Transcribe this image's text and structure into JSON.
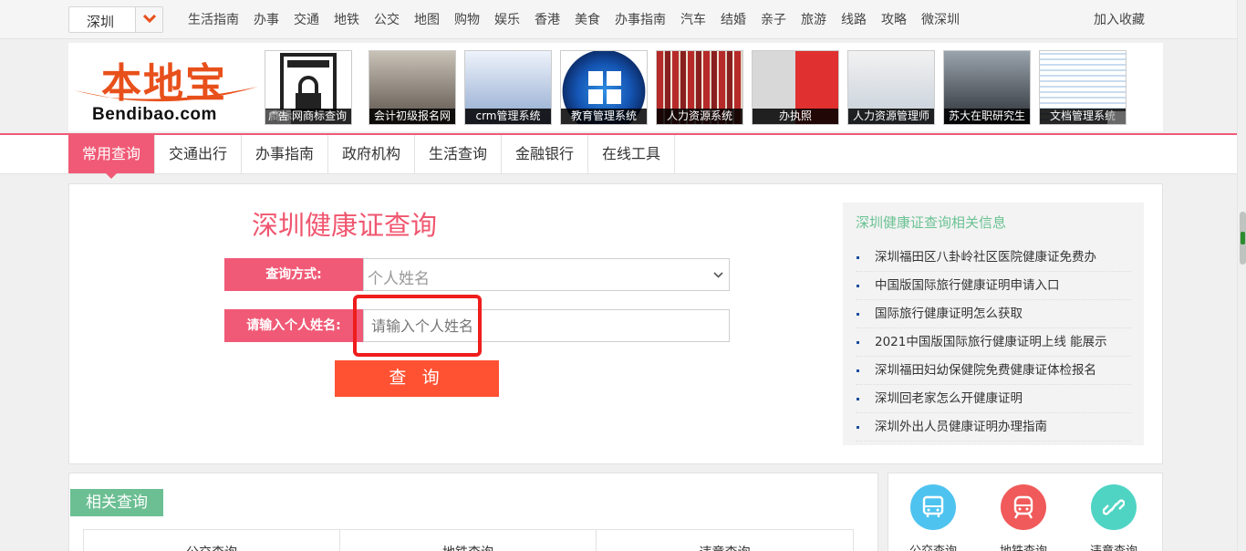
{
  "topbar": {
    "city": "深圳",
    "nav": [
      "生活指南",
      "办事",
      "交通",
      "地铁",
      "公交",
      "地图",
      "购物",
      "娱乐",
      "香港",
      "美食",
      "办事指南",
      "汽车",
      "结婚",
      "亲子",
      "旅游",
      "线路",
      "攻略",
      "微深圳"
    ],
    "favorite": "加入收藏"
  },
  "logo": {
    "cn": "本地宝",
    "en": "Bendibao.com"
  },
  "ads": {
    "tag": "广告",
    "items": [
      "商标网商标查询",
      "会计初级报名网",
      "crm管理系统",
      "教育管理系统",
      "人力资源系统",
      "办执照",
      "人力资源管理师",
      "苏大在职研究生",
      "文档管理系统"
    ]
  },
  "tabs": [
    "常用查询",
    "交通出行",
    "办事指南",
    "政府机构",
    "生活查询",
    "金融银行",
    "在线工具"
  ],
  "query": {
    "title": "深圳健康证查询",
    "method_label": "查询方式:",
    "method_value": "个人姓名",
    "name_label": "请输入个人姓名:",
    "name_placeholder": "请输入个人姓名",
    "submit": "查 询"
  },
  "related_info": {
    "title": "深圳健康证查询相关信息",
    "items": [
      "深圳福田区八卦岭社区医院健康证免费办",
      "中国版国际旅行健康证明申请入口",
      "国际旅行健康证明怎么获取",
      "2021中国版国际旅行健康证明上线 能展示",
      "深圳福田妇幼保健院免费健康证体检报名",
      "深圳回老家怎么开健康证明",
      "深圳外出人员健康证明办理指南"
    ]
  },
  "related_queries": {
    "title": "相关查询",
    "columns": [
      "公交查询",
      "地铁查询",
      "违章查询"
    ]
  },
  "quick_icons": [
    {
      "label": "公交查询",
      "color": "#4fc3ef",
      "icon": "bus-icon"
    },
    {
      "label": "地铁查询",
      "color": "#f05a5a",
      "icon": "subway-icon"
    },
    {
      "label": "违章查询",
      "color": "#4fd4c4",
      "icon": "link-icon"
    }
  ]
}
